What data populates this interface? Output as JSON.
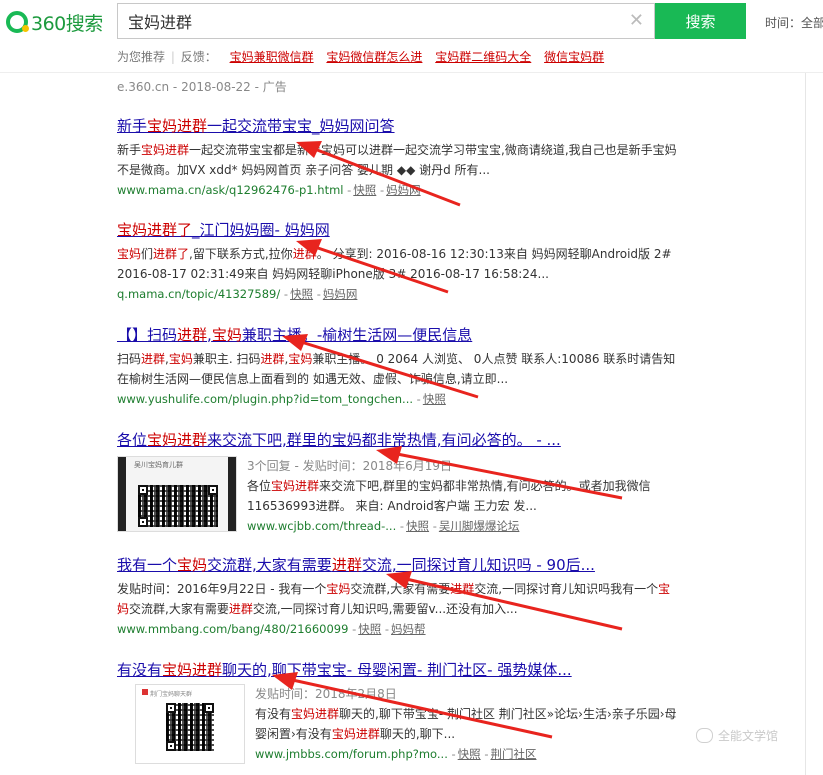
{
  "header": {
    "logo_text": "360搜索",
    "search_value": "宝妈进群",
    "clear_icon": "close-icon",
    "search_button": "搜索",
    "time_label": "时间：全部"
  },
  "recommend": {
    "label": "为您推荐",
    "feedback": "反馈：",
    "links": [
      "宝妈兼职微信群",
      "宝妈微信群怎么进",
      "宝妈群二维码大全",
      "微信宝妈群"
    ]
  },
  "ad_line": "e.360.cn - 2018-08-22 - 广告",
  "results": [
    {
      "title_parts": [
        "新手",
        "宝妈进群",
        "一起交流带宝宝_妈妈网问答"
      ],
      "snippet_parts": [
        "新手",
        "宝妈进群",
        "一起交流带宝宝都是新手宝妈可以进群一起交流学习带宝宝,微商请绕道,我自己也是新手宝妈不是微商。加VX xdd* 妈妈网首页 亲子问答 婴儿期 ◆◆ 谢丹d 所有..."
      ],
      "url": "www.mama.cn/ask/q12962476-p1.html",
      "links": [
        "快照",
        "妈妈网"
      ]
    },
    {
      "title_parts": [
        "宝妈进群了",
        "_江门妈妈圈- 妈妈网"
      ],
      "snippet_parts": [
        "宝妈",
        "们",
        "进群了",
        ",留下联系方式,拉你",
        "进群",
        "。 分享到: 2016-08-16 12:30:13来自 妈妈网轻聊Android版 2# 2016-08-17 02:31:49来自 妈妈网轻聊iPhone版 3# 2016-08-17 16:58:24..."
      ],
      "url": "q.mama.cn/topic/41327589/",
      "links": [
        "快照",
        "妈妈网"
      ]
    },
    {
      "title_parts": [
        "【】扫码",
        "进群",
        ",",
        "宝妈",
        "兼职主播。-榆树生活网—便民信息"
      ],
      "snippet_parts": [
        "扫码",
        "进群",
        ",",
        "宝妈",
        "兼职主. 扫码",
        "进群",
        ",",
        "宝妈",
        "兼职主播。 0 2064 人浏览、 0人点赞 联系人:10086 联系时请告知在榆树生活网—便民信息上面看到的 如遇无效、虚假、诈骗信息,请立即..."
      ],
      "url": "www.yushulife.com/plugin.php?id=tom_tongchen...",
      "links": [
        "快照"
      ]
    },
    {
      "title_parts": [
        "各位",
        "宝妈进群",
        "来交流下吧,群里的宝妈都非常热情,有问必答的。 - ..."
      ],
      "thumb_caption": "吴川宝妈育儿群",
      "snippet_parts": [
        "3个回复 - 发贴时间：2018年6月19日",
        "各位",
        "宝妈进群",
        "来交流下吧,群里的宝妈都非常热情,有问必答的。或者加我微信116536993进群。 来自: Android客户端 王力宏 发..."
      ],
      "url": "www.wcjbb.com/thread-...",
      "links": [
        "快照",
        "吴川脚爆爆论坛"
      ]
    },
    {
      "title_parts": [
        "我有一个",
        "宝妈",
        "交流群,大家有需要",
        "进群",
        "交流,一同探讨育儿知识吗 - 90后..."
      ],
      "snippet_parts": [
        "发贴时间：2016年9月22日 - 我有一个",
        "宝妈",
        "交流群,大家有需要",
        "进群",
        "交流,一同探讨育儿知识吗我有一个",
        "宝妈",
        "交流群,大家有需要",
        "进群",
        "交流,一同探讨育儿知识吗,需要留v...还没有加入..."
      ],
      "url": "www.mmbang.com/bang/480/21660099",
      "links": [
        "快照",
        "妈妈帮"
      ]
    },
    {
      "title_parts": [
        "有没有",
        "宝妈进群",
        "聊天的,聊下带宝宝- 母婴闲置- 荆门社区- 强势媒体..."
      ],
      "thumb_caption": "荆门宝妈聊天群",
      "snippet_parts": [
        "发贴时间：2018年2月8日",
        "有没有",
        "宝妈进群",
        "聊天的,聊下带宝宝- 荆门社区 荆门社区»论坛›生活›亲子乐园›母婴闲置›有没有",
        "宝妈进群",
        "聊天的,聊下..."
      ],
      "url": "www.jmbbs.com/forum.php?mo...",
      "links": [
        "快照",
        "荆门社区"
      ]
    }
  ],
  "watermark": "全能文学馆",
  "colors": {
    "brand": "#19b955",
    "link": "#1a0dab",
    "highlight": "#cc0000",
    "url": "#1d7d2e",
    "arrow": "#e8241e"
  }
}
